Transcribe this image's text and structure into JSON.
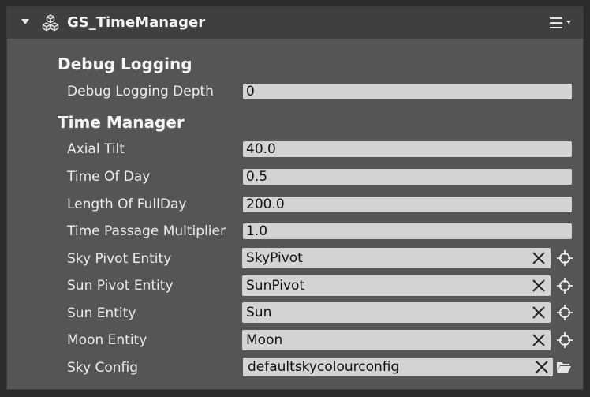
{
  "component": {
    "title": "GS_TimeManager",
    "icons": {
      "collapse": "triangle-down-icon",
      "component": "cubes-icon",
      "menu": "hamburger-menu-icon"
    }
  },
  "debug_logging": {
    "title": "Debug Logging",
    "depth_label": "Debug Logging Depth",
    "depth_value": "0"
  },
  "time_manager": {
    "title": "Time Manager",
    "axial_tilt_label": "Axial Tilt",
    "axial_tilt_value": "40.0",
    "time_of_day_label": "Time Of Day",
    "time_of_day_value": "0.5",
    "length_of_full_day_label": "Length Of FullDay",
    "length_of_full_day_value": "200.0",
    "time_passage_multiplier_label": "Time Passage Multiplier",
    "time_passage_multiplier_value": "1.0",
    "sky_pivot_entity_label": "Sky Pivot Entity",
    "sky_pivot_entity_value": "SkyPivot",
    "sun_pivot_entity_label": "Sun Pivot Entity",
    "sun_pivot_entity_value": "SunPivot",
    "sun_entity_label": "Sun Entity",
    "sun_entity_value": "Sun",
    "moon_entity_label": "Moon Entity",
    "moon_entity_value": "Moon",
    "sky_config_label": "Sky Config",
    "sky_config_value": "defaultskycolourconfig"
  },
  "colors": {
    "panel_bg": "#555555",
    "header_bg": "#3f3f3f",
    "field_bg": "#d3d3d3",
    "text": "#ececec"
  }
}
